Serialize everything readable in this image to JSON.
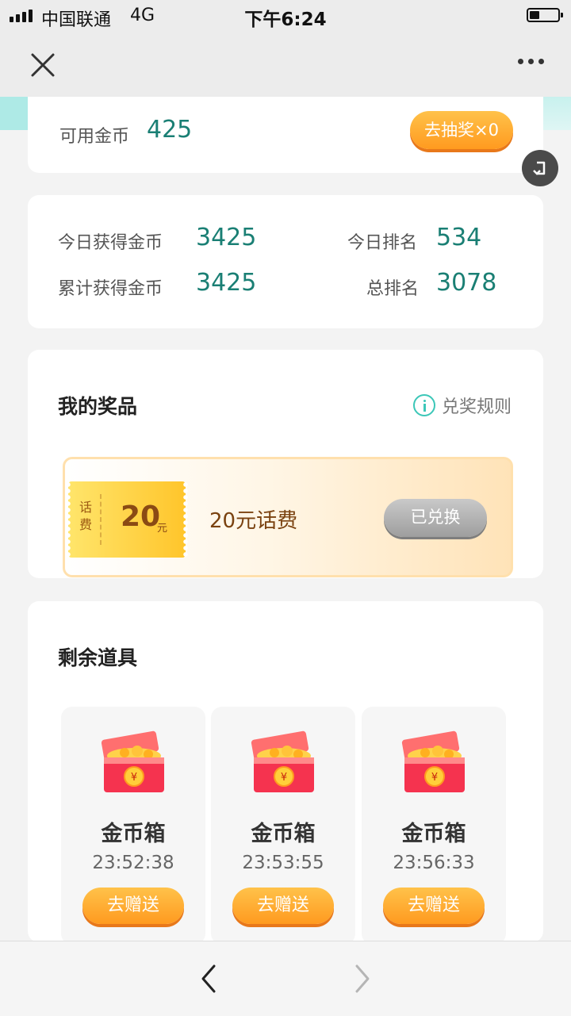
{
  "status_bar": {
    "carrier": "中国联通",
    "network": "4G",
    "time": "下午6:24",
    "icons": [
      "signal-icon",
      "battery-icon"
    ]
  },
  "nav": {
    "icons": [
      "close-icon",
      "more-icon"
    ]
  },
  "coins": {
    "label": "可用金币",
    "value": "425",
    "lottery_button": "去抽奖×0"
  },
  "stats": {
    "today_label": "今日获得金币",
    "today_value": "3425",
    "today_rank_label": "今日排名",
    "today_rank_value": "534",
    "total_label": "累计获得金币",
    "total_value": "3425",
    "total_rank_label": "总排名",
    "total_rank_value": "3078"
  },
  "prizes": {
    "title": "我的奖品",
    "rules_link": "兑奖规则",
    "items": [
      {
        "ticket_side": "话费",
        "ticket_amount": "20",
        "ticket_unit": "元",
        "name": "20元话费",
        "status_button": "已兑换"
      }
    ]
  },
  "props": {
    "title": "剩余道具",
    "items": [
      {
        "name": "金币箱",
        "timer": "23:52:38",
        "button": "去赠送",
        "icon": "treasure-chest-icon"
      },
      {
        "name": "金币箱",
        "timer": "23:53:55",
        "button": "去赠送",
        "icon": "treasure-chest-icon"
      },
      {
        "name": "金币箱",
        "timer": "23:56:33",
        "button": "去赠送",
        "icon": "treasure-chest-icon"
      }
    ]
  },
  "bottom_nav": {
    "icons": [
      "back-arrow-icon",
      "forward-arrow-icon"
    ],
    "forward_enabled": false
  },
  "colors": {
    "accent_teal": "#1a7f74",
    "orange_button": "#ff9a1f",
    "redeemed_gray": "#9e9e9e",
    "prize_text_brown": "#7a4210"
  }
}
